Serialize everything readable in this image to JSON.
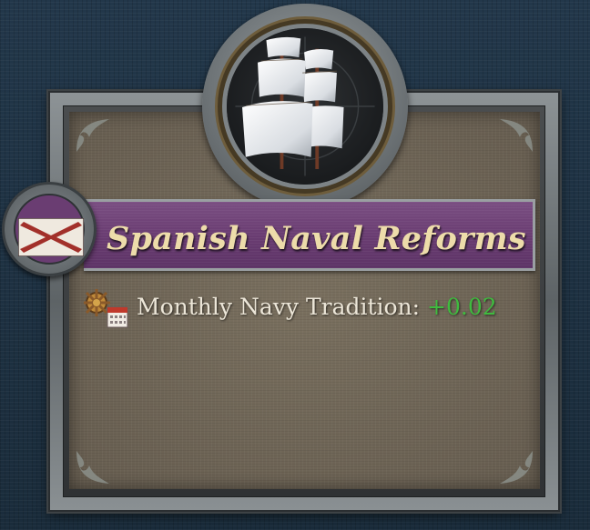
{
  "title": "Spanish Naval Reforms",
  "effect": {
    "label": "Monthly Navy Tradition:",
    "value": "+0.02",
    "value_color": "#3fbb3f",
    "icon": "navy-tradition-calendar-icon"
  },
  "images": {
    "medallion": "galleon-ship-icon",
    "flag": "cross-of-burgundy-flag-icon"
  },
  "colors": {
    "banner": "#6a3d72",
    "title_text": "#eddcaa",
    "panel": "#72685a",
    "background": "#1e3040"
  }
}
